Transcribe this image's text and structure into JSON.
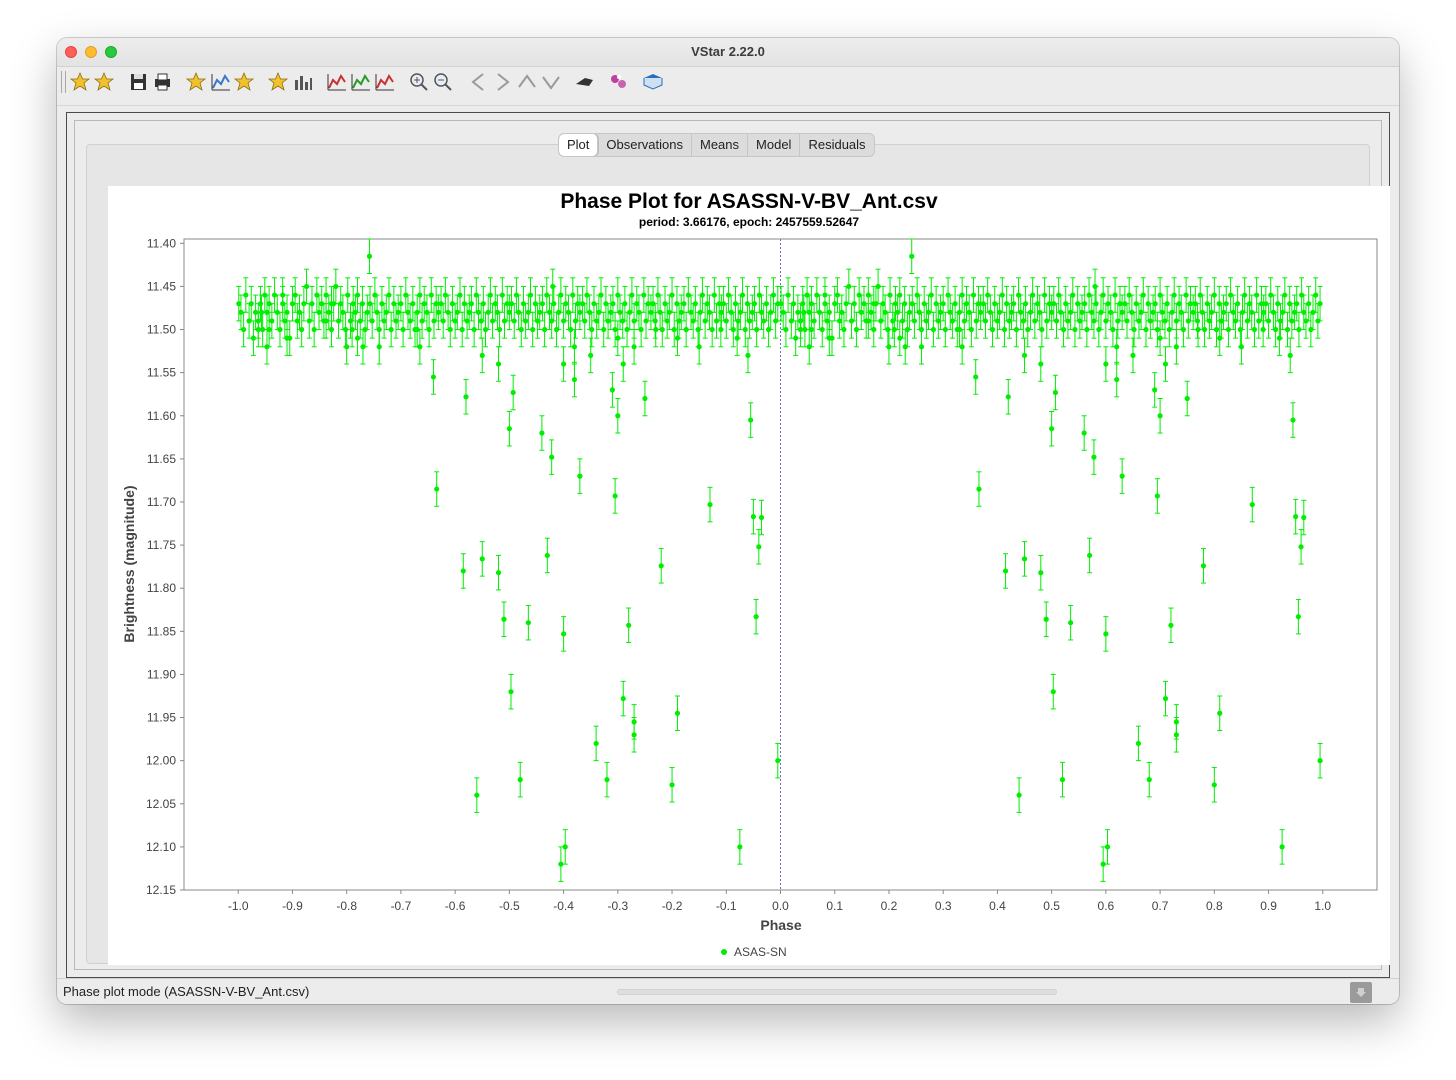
{
  "window": {
    "title": "VStar 2.22.0"
  },
  "toolbar": {
    "buttons": [
      {
        "name": "new-star-icon",
        "color": "#f2c12e"
      },
      {
        "name": "open-file-icon",
        "color": "#f2c12e"
      },
      {
        "name": "save-icon",
        "color": "#333333"
      },
      {
        "name": "print-icon",
        "color": "#333333"
      },
      {
        "name": "info-star-icon",
        "color": "#f2c12e"
      },
      {
        "name": "observation-details-icon",
        "color": "#3a78c8"
      },
      {
        "name": "time-star-icon",
        "color": "#f2c12e"
      },
      {
        "name": "star-plot-icon",
        "color": "#f2c12e"
      },
      {
        "name": "raw-data-icon",
        "color": "#555555"
      },
      {
        "name": "plot-toggle-icon",
        "color": "#c83232"
      },
      {
        "name": "phase-plot-icon",
        "color": "#2a9a2a"
      },
      {
        "name": "mean-curve-icon",
        "color": "#c83232"
      },
      {
        "name": "zoom-in-icon",
        "color": "#555555"
      },
      {
        "name": "zoom-out-icon",
        "color": "#555555"
      },
      {
        "name": "pan-left-icon",
        "color": "#9a9a9a"
      },
      {
        "name": "pan-right-icon",
        "color": "#9a9a9a"
      },
      {
        "name": "pan-up-icon",
        "color": "#9a9a9a"
      },
      {
        "name": "pan-down-icon",
        "color": "#9a9a9a"
      },
      {
        "name": "filter-icon",
        "color": "#333333"
      },
      {
        "name": "plugin-icon",
        "color": "#c040a0"
      },
      {
        "name": "help-book-icon",
        "color": "#2a6fb8"
      }
    ]
  },
  "tabs": [
    {
      "label": "Plot",
      "active": true
    },
    {
      "label": "Observations",
      "active": false
    },
    {
      "label": "Means",
      "active": false
    },
    {
      "label": "Model",
      "active": false
    },
    {
      "label": "Residuals",
      "active": false
    }
  ],
  "status": {
    "text": "Phase plot mode (ASASSN-V-BV_Ant.csv)"
  },
  "chart_data": {
    "type": "scatter",
    "title": "Phase Plot for ASASSN-V-BV_Ant.csv",
    "subtitle": "period: 3.66176, epoch: 2457559.52647",
    "xlabel": "Phase",
    "ylabel": "Brightness (magnitude)",
    "xlim": [
      -1.1,
      1.1
    ],
    "ylim": [
      12.15,
      11.395
    ],
    "y_inverted": true,
    "x_ticks": [
      "-1.0",
      "-0.9",
      "-0.8",
      "-0.7",
      "-0.6",
      "-0.5",
      "-0.4",
      "-0.3",
      "-0.2",
      "-0.1",
      "0.0",
      "0.1",
      "0.2",
      "0.3",
      "0.4",
      "0.5",
      "0.6",
      "0.7",
      "0.8",
      "0.9",
      "1.0"
    ],
    "y_ticks": [
      "11.40",
      "11.45",
      "11.50",
      "11.55",
      "11.60",
      "11.65",
      "11.70",
      "11.75",
      "11.80",
      "11.85",
      "11.90",
      "11.95",
      "12.00",
      "12.05",
      "12.10",
      "12.15"
    ],
    "legend": "bottom-center",
    "grid": false,
    "zero_line": true,
    "series": [
      {
        "name": "ASAS-SN",
        "color": "#00ee00",
        "error": 0.02,
        "phases": [
          -0.999,
          -0.995,
          -0.99,
          -0.986,
          -0.98,
          -0.976,
          -0.972,
          -0.968,
          -0.963,
          -0.959,
          -0.955,
          -0.951,
          -0.947,
          -0.943,
          -0.938,
          -0.933,
          -0.928,
          -0.923,
          -0.918,
          -0.914,
          -0.91,
          -0.905,
          -0.9,
          -0.895,
          -0.891,
          -0.887,
          -0.883,
          -0.879,
          -0.874,
          -0.869,
          -0.864,
          -0.86,
          -0.855,
          -0.851,
          -0.846,
          -0.842,
          -0.838,
          -0.833,
          -0.828,
          -0.824,
          -0.82,
          -0.815,
          -0.811,
          -0.807,
          -0.802,
          -0.798,
          -0.793,
          -0.788,
          -0.784,
          -0.78,
          -0.775,
          -0.771,
          -0.766,
          -0.762,
          -0.757,
          -0.753,
          -0.748,
          -0.744,
          -0.74,
          -0.735,
          -0.731,
          -0.727,
          -0.722,
          -0.718,
          -0.713,
          -0.709,
          -0.705,
          -0.7,
          -0.696,
          -0.691,
          -0.687,
          -0.683,
          -0.678,
          -0.674,
          -0.67,
          -0.665,
          -0.661,
          -0.657,
          -0.652,
          -0.648,
          -0.644,
          -0.639,
          -0.635,
          -0.631,
          -0.626,
          -0.622,
          -0.618,
          -0.613,
          -0.609,
          -0.605,
          -0.6,
          -0.596,
          -0.591,
          -0.587,
          -0.583,
          -0.578,
          -0.574,
          -0.57,
          -0.565,
          -0.561,
          -0.557,
          -0.552,
          -0.548,
          -0.544,
          -0.539,
          -0.535,
          -0.531,
          -0.526,
          -0.522,
          -0.518,
          -0.513,
          -0.509,
          -0.504,
          -0.5,
          -0.496,
          -0.491,
          -0.487,
          -0.483,
          -0.478,
          -0.474,
          -0.47,
          -0.465,
          -0.461,
          -0.457,
          -0.452,
          -0.448,
          -0.444,
          -0.439,
          -0.435,
          -0.431,
          -0.426,
          -0.422,
          -0.418,
          -0.413,
          -0.409,
          -0.405,
          -0.4,
          -0.396,
          -0.391,
          -0.387,
          -0.383,
          -0.378,
          -0.374,
          -0.37,
          -0.365,
          -0.361,
          -0.357,
          -0.352,
          -0.348,
          -0.344,
          -0.339,
          -0.335,
          -0.331,
          -0.326,
          -0.322,
          -0.318,
          -0.313,
          -0.309,
          -0.305,
          -0.3,
          -0.296,
          -0.291,
          -0.287,
          -0.283,
          -0.278,
          -0.274,
          -0.27,
          -0.265,
          -0.261,
          -0.257,
          -0.252,
          -0.248,
          -0.244,
          -0.239,
          -0.235,
          -0.231,
          -0.226,
          -0.222,
          -0.218,
          -0.213,
          -0.209,
          -0.205,
          -0.2,
          -0.196,
          -0.191,
          -0.187,
          -0.183,
          -0.178,
          -0.174,
          -0.17,
          -0.165,
          -0.161,
          -0.157,
          -0.152,
          -0.148,
          -0.144,
          -0.139,
          -0.135,
          -0.131,
          -0.126,
          -0.122,
          -0.118,
          -0.113,
          -0.109,
          -0.105,
          -0.1,
          -0.096,
          -0.091,
          -0.087,
          -0.083,
          -0.078,
          -0.074,
          -0.07,
          -0.065,
          -0.061,
          -0.057,
          -0.052,
          -0.048,
          -0.044,
          -0.039,
          -0.035,
          -0.031,
          -0.026,
          -0.022,
          -0.018,
          -0.013,
          -0.009,
          -0.005,
          -0.957,
          -0.943,
          -0.918,
          -0.838,
          -0.828,
          -0.8,
          -0.78,
          -0.77,
          -0.758,
          -0.74,
          -0.67,
          -0.64,
          -0.55,
          -0.52,
          -0.42,
          -0.4,
          -0.38,
          -0.35,
          -0.3,
          -0.29,
          -0.27,
          -0.23,
          -0.19,
          -0.15,
          -0.11,
          -0.08,
          -0.06,
          -0.963,
          -0.947,
          -0.91,
          -0.79,
          -0.665,
          -0.634,
          -0.585,
          -0.58,
          -0.56,
          -0.55,
          -0.52,
          -0.51,
          -0.5,
          -0.497,
          -0.493,
          -0.48,
          -0.465,
          -0.44,
          -0.43,
          -0.422,
          -0.405,
          -0.4,
          -0.397,
          -0.38,
          -0.37,
          -0.34,
          -0.32,
          -0.31,
          -0.305,
          -0.3,
          -0.29,
          -0.28,
          -0.27,
          -0.27,
          -0.25,
          -0.22,
          -0.2,
          -0.19,
          -0.13,
          -0.075,
          -0.055,
          -0.05,
          -0.045,
          -0.04,
          -0.035,
          -0.005
        ],
        "values": [
          11.47,
          11.48,
          11.5,
          11.46,
          11.49,
          11.47,
          11.51,
          11.48,
          11.49,
          11.47,
          11.5,
          11.46,
          11.48,
          11.47,
          11.49,
          11.46,
          11.48,
          11.5,
          11.47,
          11.49,
          11.48,
          11.51,
          11.47,
          11.46,
          11.49,
          11.48,
          11.5,
          11.47,
          11.45,
          11.49,
          11.47,
          11.5,
          11.46,
          11.48,
          11.47,
          11.49,
          11.46,
          11.48,
          11.5,
          11.47,
          11.45,
          11.49,
          11.47,
          11.48,
          11.5,
          11.46,
          11.49,
          11.47,
          11.48,
          11.46,
          11.49,
          11.47,
          11.5,
          11.48,
          11.47,
          11.49,
          11.46,
          11.48,
          11.5,
          11.47,
          11.49,
          11.48,
          11.46,
          11.5,
          11.47,
          11.49,
          11.48,
          11.47,
          11.5,
          11.46,
          11.48,
          11.49,
          11.47,
          11.5,
          11.48,
          11.46,
          11.49,
          11.47,
          11.48,
          11.5,
          11.46,
          11.49,
          11.47,
          11.48,
          11.47,
          11.49,
          11.46,
          11.48,
          11.5,
          11.47,
          11.49,
          11.48,
          11.46,
          11.5,
          11.47,
          11.49,
          11.48,
          11.47,
          11.5,
          11.46,
          11.48,
          11.49,
          11.47,
          11.5,
          11.48,
          11.46,
          11.49,
          11.47,
          11.48,
          11.5,
          11.46,
          11.49,
          11.47,
          11.48,
          11.47,
          11.49,
          11.46,
          11.48,
          11.5,
          11.47,
          11.49,
          11.48,
          11.46,
          11.5,
          11.47,
          11.49,
          11.48,
          11.47,
          11.5,
          11.46,
          11.48,
          11.49,
          11.47,
          11.5,
          11.48,
          11.46,
          11.49,
          11.47,
          11.48,
          11.5,
          11.46,
          11.49,
          11.47,
          11.48,
          11.47,
          11.49,
          11.46,
          11.48,
          11.5,
          11.47,
          11.49,
          11.48,
          11.46,
          11.5,
          11.47,
          11.49,
          11.48,
          11.47,
          11.5,
          11.46,
          11.48,
          11.49,
          11.47,
          11.5,
          11.48,
          11.46,
          11.49,
          11.47,
          11.48,
          11.5,
          11.46,
          11.49,
          11.47,
          11.48,
          11.47,
          11.49,
          11.46,
          11.48,
          11.5,
          11.47,
          11.49,
          11.48,
          11.46,
          11.5,
          11.47,
          11.49,
          11.48,
          11.47,
          11.5,
          11.46,
          11.48,
          11.49,
          11.47,
          11.5,
          11.48,
          11.46,
          11.49,
          11.47,
          11.48,
          11.5,
          11.46,
          11.49,
          11.47,
          11.48,
          11.47,
          11.49,
          11.46,
          11.48,
          11.5,
          11.47,
          11.49,
          11.48,
          11.46,
          11.5,
          11.47,
          11.49,
          11.48,
          11.47,
          11.5,
          11.46,
          11.48,
          11.49,
          11.47,
          11.5,
          11.48,
          11.46,
          11.49,
          11.47,
          11.48,
          11.5,
          11.46,
          11.49,
          11.47,
          11.52,
          11.51,
          11.52,
          11.415,
          11.52,
          11.5,
          11.555,
          11.53,
          11.54,
          11.45,
          11.54,
          11.52,
          11.53,
          11.51,
          11.54,
          11.52,
          11.5,
          11.51,
          11.52,
          11.5,
          11.51,
          11.53,
          11.5,
          11.52,
          11.51,
          11.5,
          11.52,
          11.685,
          11.78,
          11.578,
          12.04,
          11.766,
          11.782,
          11.836,
          11.615,
          11.92,
          11.573,
          12.022,
          11.84,
          11.62,
          11.762,
          11.648,
          12.12,
          11.853,
          12.1,
          11.558,
          11.67,
          11.98,
          12.022,
          11.57,
          11.693,
          11.6,
          11.928,
          11.843,
          11.955,
          11.97,
          11.58,
          11.774,
          12.028,
          11.945,
          11.703,
          12.1,
          11.605,
          11.717,
          11.833,
          11.752,
          11.718,
          12.0,
          11.98,
          11.61
        ]
      }
    ]
  }
}
